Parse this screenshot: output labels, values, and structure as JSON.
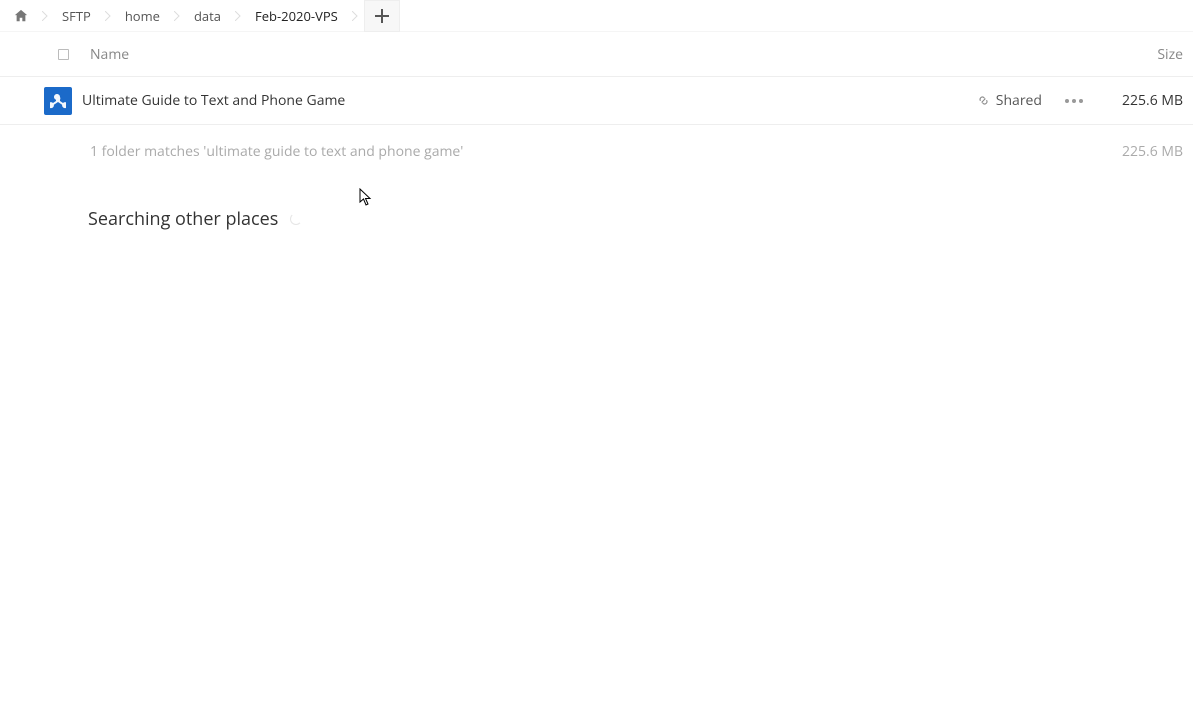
{
  "breadcrumb": [
    {
      "label": "SFTP"
    },
    {
      "label": "home"
    },
    {
      "label": "data"
    },
    {
      "label": "Feb-2020-VPS",
      "current": true
    }
  ],
  "columns": {
    "name": "Name",
    "size": "Size"
  },
  "files": [
    {
      "name": "Ultimate Guide to Text and Phone Game",
      "shared_label": "Shared",
      "size": "225.6 MB"
    }
  ],
  "summary": {
    "text": "1 folder matches 'ultimate guide to text and phone game'",
    "size": "225.6 MB"
  },
  "searching_label": "Searching other places"
}
